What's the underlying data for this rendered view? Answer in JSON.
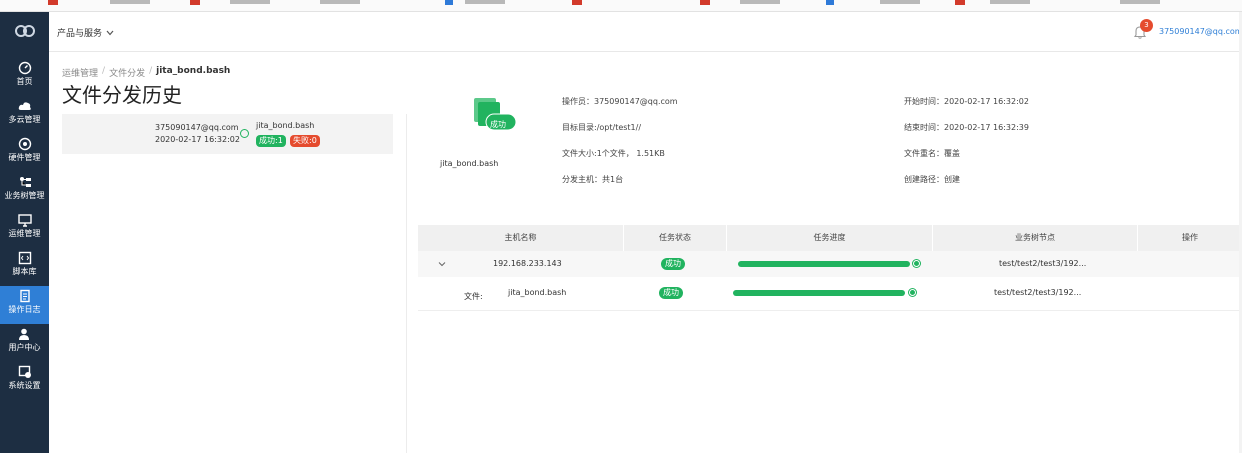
{
  "header": {
    "menu_label": "产品与服务",
    "notification_count": "3",
    "user_email": "375090147@qq.com"
  },
  "sidebar": {
    "items": [
      {
        "label": "首页",
        "icon": "dashboard-icon"
      },
      {
        "label": "多云管理",
        "icon": "cloud-icon"
      },
      {
        "label": "硬件管理",
        "icon": "hardware-icon"
      },
      {
        "label": "业务树管理",
        "icon": "tree-icon"
      },
      {
        "label": "运维管理",
        "icon": "monitor-icon"
      },
      {
        "label": "脚本库",
        "icon": "script-icon"
      },
      {
        "label": "操作日志",
        "icon": "log-icon"
      },
      {
        "label": "用户中心",
        "icon": "user-icon"
      },
      {
        "label": "系统设置",
        "icon": "settings-icon"
      }
    ],
    "active_index": 6
  },
  "breadcrumb": {
    "level1": "运维管理",
    "level2": "文件分发",
    "current": "jita_bond.bash"
  },
  "page": {
    "title": "文件分发历史"
  },
  "record": {
    "user": "375090147@qq.com",
    "time": "2020-02-17 16:32:02",
    "file": "jita_bond.bash",
    "success_tag": "成功:1",
    "fail_tag": "失败:0"
  },
  "detail": {
    "file_status": "成功",
    "file_name": "jita_bond.bash",
    "operator": "操作员：375090147@qq.com",
    "target_dir": "目标目录:/opt/test1//",
    "file_size": "文件大小:1个文件，  1.51KB",
    "hosts": "分发主机：共1台",
    "start_time": "开始时间：2020-02-17 16:32:02",
    "end_time": "结束时间：2020-02-17 16:32:39",
    "rename": "文件重名：覆盖",
    "create_path": "创建路径：创建"
  },
  "table": {
    "headers": [
      "主机名称",
      "任务状态",
      "任务进度",
      "业务树节点",
      "操作"
    ],
    "rows": [
      {
        "host": "192.168.233.143",
        "status": "成功",
        "progress": 1.0,
        "node": "test/test2/test3/192..."
      },
      {
        "file_label": "文件:",
        "file": "jita_bond.bash",
        "status": "成功",
        "progress": 1.0,
        "node": "test/test2/test3/192..."
      }
    ]
  },
  "colors": {
    "sidebar_bg": "#1d2e42",
    "sidebar_active": "#2f7fd6",
    "success": "#21b35f",
    "danger": "#e54b2e",
    "link": "#2f7fd6"
  }
}
